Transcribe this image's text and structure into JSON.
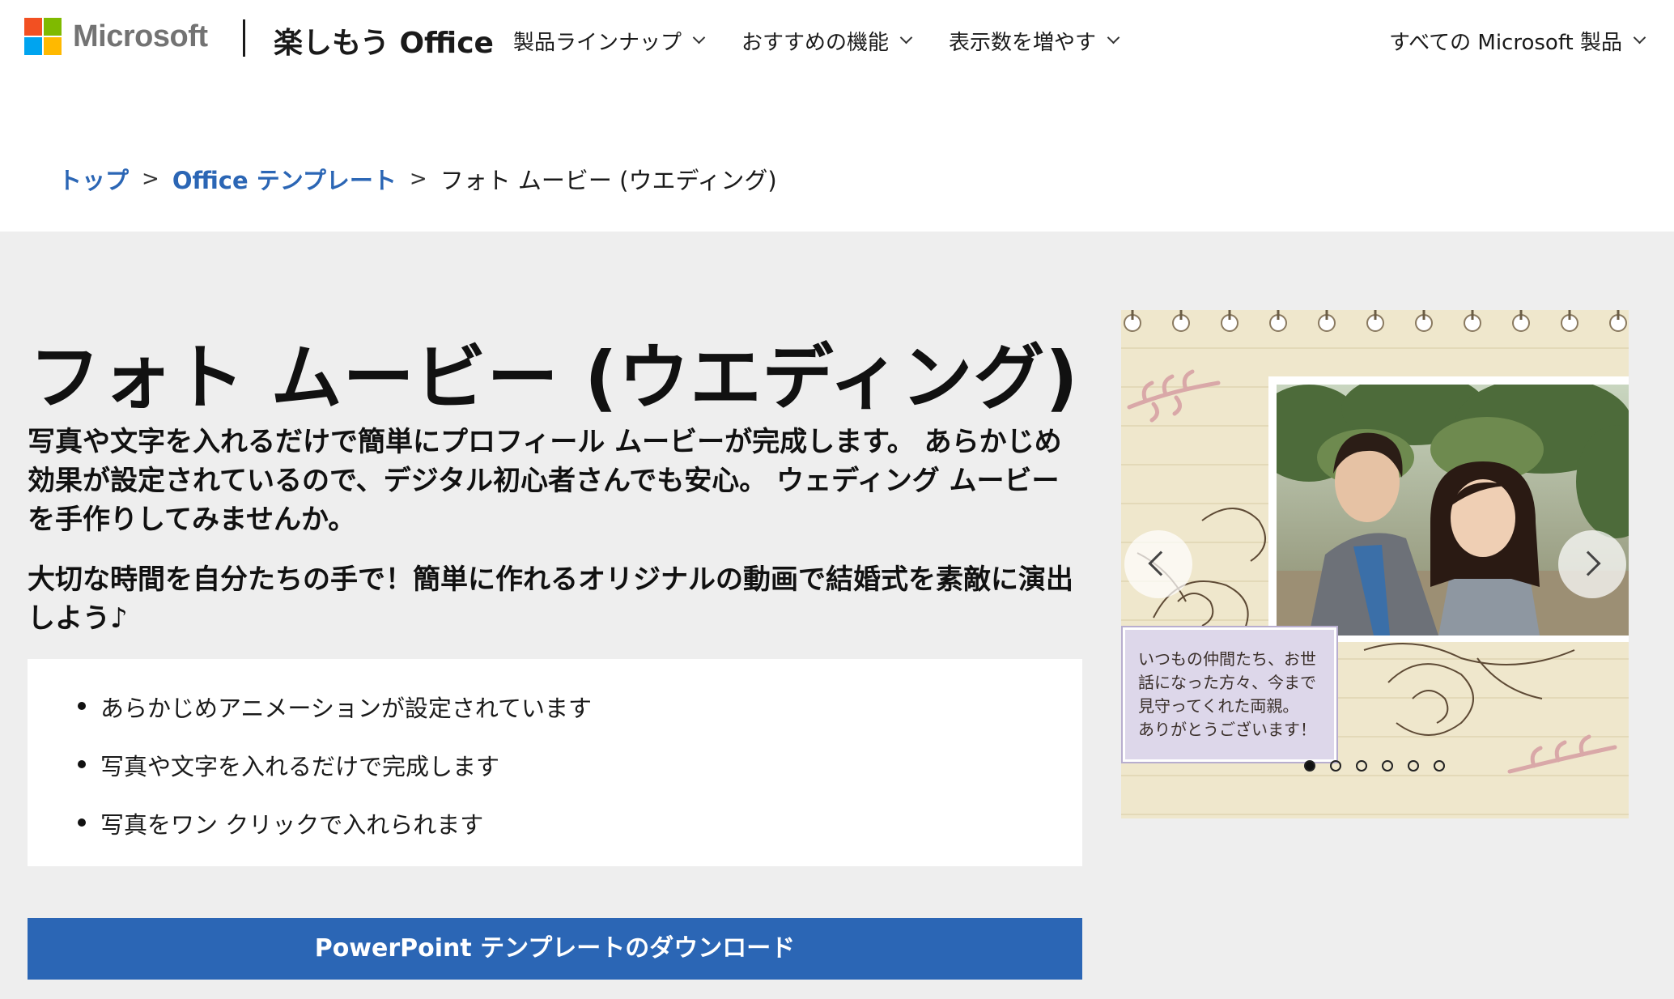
{
  "header": {
    "logo_text": "Microsoft",
    "brand_title": "楽しもう Office",
    "nav": [
      {
        "label": "製品ラインナップ"
      },
      {
        "label": "おすすめの機能"
      },
      {
        "label": "表示数を増やす"
      }
    ],
    "all_products": "すべての Microsoft 製品"
  },
  "breadcrumb": {
    "home": "トップ",
    "templates": "Office テンプレート",
    "current": "フォト ムービー (ウエディング)",
    "separator": ">"
  },
  "main": {
    "title": "フォト ムービー (ウエディング)",
    "lead1": "写真や文字を入れるだけで簡単にプロフィール ムービーが完成します。 あらかじめ効果が設定されているので、デジタル初心者さんでも安心。 ウェディング ムービーを手作りしてみませんか。",
    "lead2": "大切な時間を自分たちの手で！簡単に作れるオリジナルの動画で結婚式を素敵に演出しよう♪",
    "features": [
      "あらかじめアニメーションが設定されています",
      "写真や文字を入れるだけで完成します",
      "写真をワン クリックで入れられます"
    ],
    "download_label": "PowerPoint テンプレートのダウンロード"
  },
  "carousel": {
    "caption_lines": [
      "いつもの仲間たち、お世",
      "話になった方々、今まで",
      "見守ってくれた両親。",
      "ありがとうございます！"
    ],
    "slide_count": 6,
    "active_index": 0,
    "prev_icon": "chevron-left-icon",
    "next_icon": "chevron-right-icon"
  },
  "colors": {
    "link": "#2b66b5",
    "button_bg": "#2b66b5",
    "band_bg": "#eeeeee",
    "ms_red": "#f25022",
    "ms_green": "#7fba00",
    "ms_blue": "#00a4ef",
    "ms_yellow": "#ffb900"
  }
}
